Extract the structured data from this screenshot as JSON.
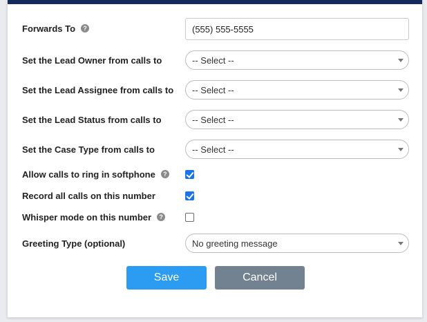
{
  "colors": {
    "header_bar": "#14295c",
    "save_button": "#2b9cf2",
    "cancel_button": "#738291",
    "checkbox_checked": "#1a73e8"
  },
  "help_glyph": "?",
  "form": {
    "forwards_to": {
      "label": "Forwards To",
      "value": "(555) 555-5555",
      "has_help": true
    },
    "lead_owner": {
      "label": "Set the Lead Owner from calls to",
      "selected": "-- Select --"
    },
    "lead_assignee": {
      "label": "Set the Lead Assignee from calls to",
      "selected": "-- Select --"
    },
    "lead_status": {
      "label": "Set the Lead Status from calls to",
      "selected": "-- Select --"
    },
    "case_type": {
      "label": "Set the Case Type from calls to",
      "selected": "-- Select --"
    },
    "allow_softphone": {
      "label": "Allow calls to ring in softphone",
      "checked": true,
      "has_help": true
    },
    "record_calls": {
      "label": "Record all calls on this number",
      "checked": true
    },
    "whisper_mode": {
      "label": "Whisper mode on this number",
      "checked": false,
      "has_help": true
    },
    "greeting_type": {
      "label": "Greeting Type (optional)",
      "selected": "No greeting message"
    }
  },
  "buttons": {
    "save": "Save",
    "cancel": "Cancel"
  }
}
